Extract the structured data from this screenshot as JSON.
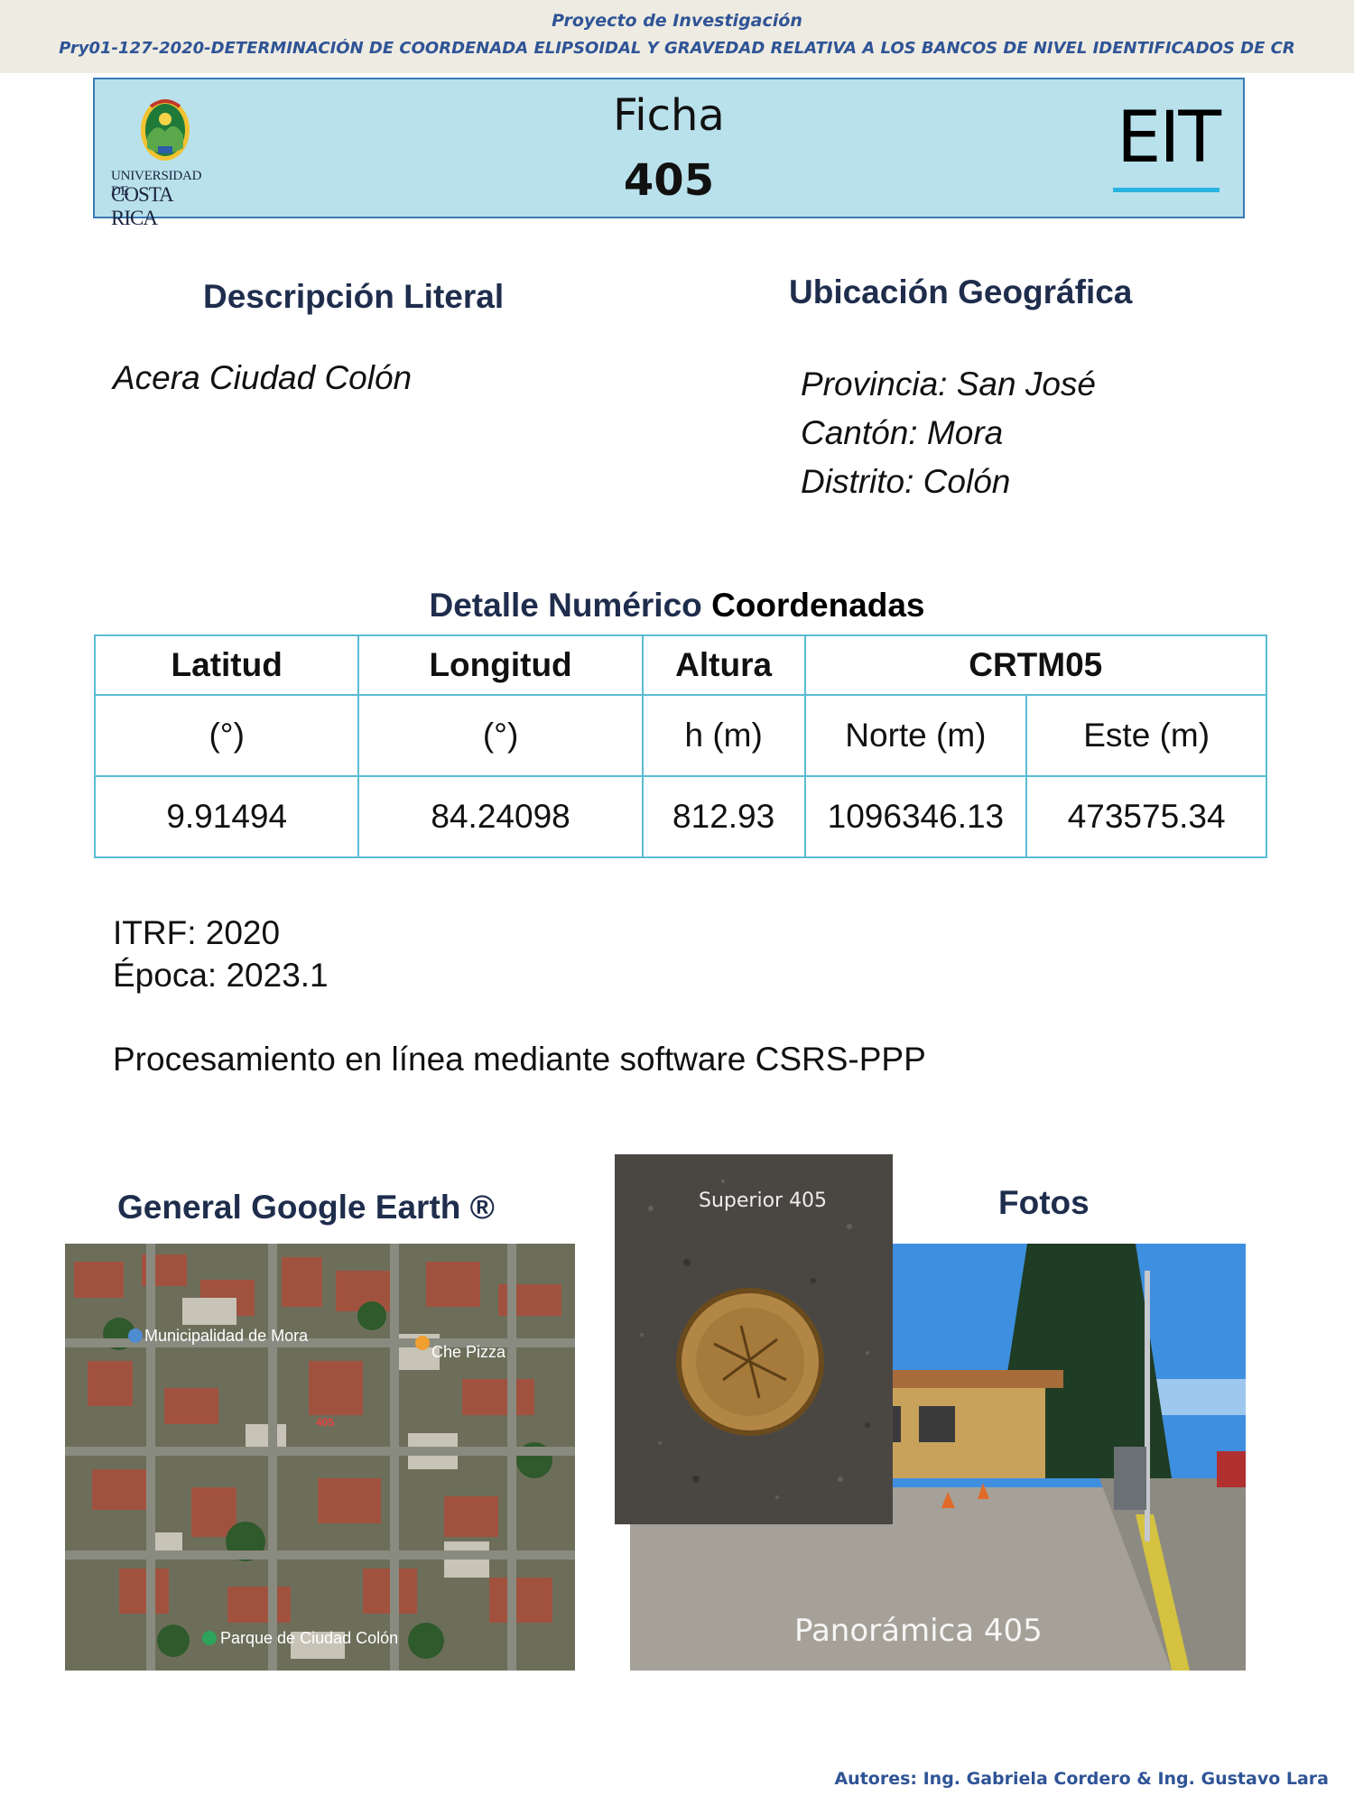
{
  "topbar": {
    "line1": "Proyecto de Investigación",
    "line2": "Pry01-127-2020-DETERMINACIÓN DE COORDENADA ELIPSOIDAL Y GRAVEDAD RELATIVA A LOS BANCOS DE NIVEL IDENTIFICADOS DE CR"
  },
  "header": {
    "logo_line1": "UNIVERSIDAD DE",
    "logo_line2": "COSTA RICA",
    "ficha_label": "Ficha",
    "ficha_number": "405",
    "eit": "EIT"
  },
  "descripcion": {
    "title": "Descripción Literal",
    "text": "Acera Ciudad Colón"
  },
  "ubicacion": {
    "title": "Ubicación Geográfica",
    "provincia": "Provincia: San José",
    "canton": "Cantón: Mora",
    "distrito": "Distrito: Colón"
  },
  "detalle": {
    "title_part1": "Detalle Numérico",
    "title_part2": "Coordenadas"
  },
  "table": {
    "headers": [
      "Latitud",
      "Longitud",
      "Altura",
      "CRTM05"
    ],
    "units": [
      "(°)",
      "(°)",
      "h (m)",
      "Norte (m)",
      "Este (m)"
    ],
    "values": [
      "9.91494",
      "84.24098",
      "812.93",
      "1096346.13",
      "473575.34"
    ]
  },
  "itrf": "ITRF: 2020",
  "epoca": "Época: 2023.1",
  "procesamiento": "Procesamiento en línea mediante software CSRS-PPP",
  "images": {
    "google_title": "General Google Earth ®",
    "fotos_title": "Fotos",
    "map_label_municipalidad": "Municipalidad de Mora",
    "map_label_pizza": "Che Pizza",
    "map_label_marker": "405",
    "map_label_parque": "Parque de Ciudad Colón",
    "superior_label": "Superior 405",
    "panoramica_label": "Panorámica 405"
  },
  "footer": "Autores: Ing. Gabriela Cordero & Ing. Gustavo Lara"
}
